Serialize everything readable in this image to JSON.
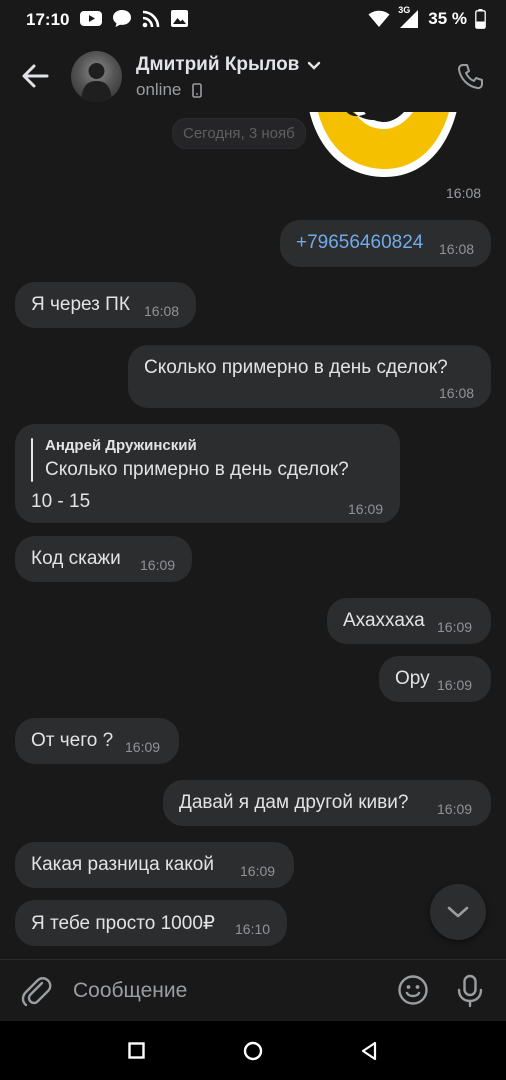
{
  "status_bar": {
    "time": "17:10",
    "network": "3G",
    "battery": "35 %"
  },
  "header": {
    "name": "Дмитрий Крылов",
    "status": "online"
  },
  "chat": {
    "date_divider": "Сегодня, 3 нояб",
    "sticker_time": "16:08",
    "messages": [
      {
        "text": "+79656460824",
        "time": "16:08",
        "outgoing": true
      },
      {
        "text": "Я через ПК",
        "time": "16:08",
        "outgoing": false
      },
      {
        "text": "Сколько примерно в день сделок?",
        "time": "16:08",
        "outgoing": true
      },
      {
        "reply_author": "Андрей Дружинский",
        "reply_text": "Сколько примерно в день сделок?",
        "text": "10 - 15",
        "time": "16:09",
        "outgoing": false
      },
      {
        "text": "Код скажи",
        "time": "16:09",
        "outgoing": false
      },
      {
        "text": "Ахаххаха",
        "time": "16:09",
        "outgoing": true
      },
      {
        "text": "Ору",
        "time": "16:09",
        "outgoing": true
      },
      {
        "text": "От чего ?",
        "time": "16:09",
        "outgoing": false
      },
      {
        "text": "Давай я дам другой киви?",
        "time": "16:09",
        "outgoing": true
      },
      {
        "text": "Какая разница какой",
        "time": "16:09",
        "outgoing": false
      },
      {
        "text": "Я тебе просто 1000₽",
        "time": "16:10",
        "outgoing": false
      }
    ]
  },
  "composer": {
    "placeholder": "Сообщение"
  },
  "colors": {
    "background": "#19191a",
    "bubble": "#2c2d2e",
    "link": "#71aaeb",
    "sticker": "#f5c000"
  },
  "icons": [
    "back-arrow-icon",
    "chevron-down-icon",
    "mobile-icon",
    "phone-icon",
    "paperclip-icon",
    "emoji-icon",
    "microphone-icon",
    "scroll-down-icon"
  ]
}
